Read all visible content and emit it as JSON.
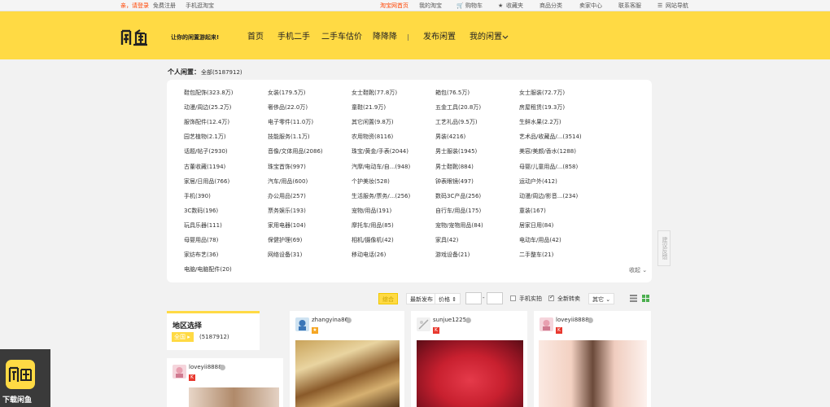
{
  "topbar": {
    "greeting": "亲，请登录",
    "register": "免费注册",
    "mobile": "手机逛淘宝",
    "home": "淘宝网首页",
    "my_taobao": "我的淘宝",
    "cart": "购物车",
    "favorites": "收藏夹",
    "categories": "商品分类",
    "seller": "卖家中心",
    "support": "联系客服",
    "sitenav": "网站导航"
  },
  "header": {
    "logo_text": "闲鱼",
    "slogan": "让你的闲置游起来!",
    "nav": [
      "首页",
      "手机二手",
      "二手车估价",
      "降降降",
      "|",
      "发布闲置",
      "我的闲置"
    ]
  },
  "breadcrumb": {
    "title": "个人闲置：",
    "count": "全部(5187912)"
  },
  "categories": {
    "columns": [
      [
        "鞋包配饰(323.8万)",
        "动漫/周边(25.2万)",
        "服饰配件(12.4万)",
        "园艺植物(2.1万)",
        "话题/帖子(2930)",
        "古董收藏(1194)",
        "家居/日用品(766)",
        "手机(390)",
        "3C数码(196)",
        "玩具乐器(111)",
        "母婴用品(78)",
        "家纺布艺(36)",
        "电脑/电脑配件(20)"
      ],
      [
        "女装(179.5万)",
        "奢侈品(22.0万)",
        "电子零件(11.0万)",
        "技能服务(1.1万)",
        "音像/文体用品(2086)",
        "珠宝首饰(997)",
        "汽车/用品(600)",
        "办公用品(257)",
        "票务娱乐(193)",
        "家用电器(104)",
        "保健护理(69)",
        "网络设备(31)"
      ],
      [
        "女士鞋靴(77.8万)",
        "童鞋(21.9万)",
        "其它闲置(9.8万)",
        "农用物资(8116)",
        "珠宝/黄金/手表(2044)",
        "汽摩/电动车/自...(948)",
        "个护美妆(528)",
        "生活服务/票务/...(256)",
        "宠物/用品(191)",
        "摩托车/用品(85)",
        "相机/摄像机(42)",
        "移动电话(26)"
      ],
      [
        "箱包(76.5万)",
        "五金工具(20.8万)",
        "工艺礼品(9.5万)",
        "男装(4216)",
        "男士服装(1945)",
        "男士鞋靴(884)",
        "钟表眼镜(497)",
        "数码3C产品(256)",
        "自行车/用品(175)",
        "宠物/宠物用品(84)",
        "家具(42)",
        "游戏设备(21)"
      ],
      [
        "女士服装(72.7万)",
        "房屋租赁(19.3万)",
        "生鲜水果(2.2万)",
        "艺术品/收藏品/...(3514)",
        "美容/美颜/香水(1288)",
        "母婴/儿童用品/...(858)",
        "运动户外(412)",
        "动漫/周边/影音...(234)",
        "童装(167)",
        "居家日用(84)",
        "电动车/用品(42)",
        "二手整车(21)"
      ]
    ],
    "collapse": "收起"
  },
  "feedback": "建议反馈",
  "filters": {
    "sort_default": "综合",
    "sort_new": "最新发布",
    "sort_price": "价格",
    "dash": "-",
    "phone_real": "手机实拍",
    "all_new": "全新转卖",
    "other": "其它"
  },
  "region": {
    "title": "地区选择",
    "button": "全国",
    "count": "(5187912)"
  },
  "cards": [
    {
      "user": "zhangyina86"
    },
    {
      "user": "sunjue1225"
    },
    {
      "user": "loveyii8888"
    },
    {
      "user": "loveyii8888"
    }
  ],
  "download": {
    "label": "下载闲鱼"
  },
  "colors": {
    "brand_yellow": "#ffda44",
    "accent_orange": "#ff4400"
  }
}
